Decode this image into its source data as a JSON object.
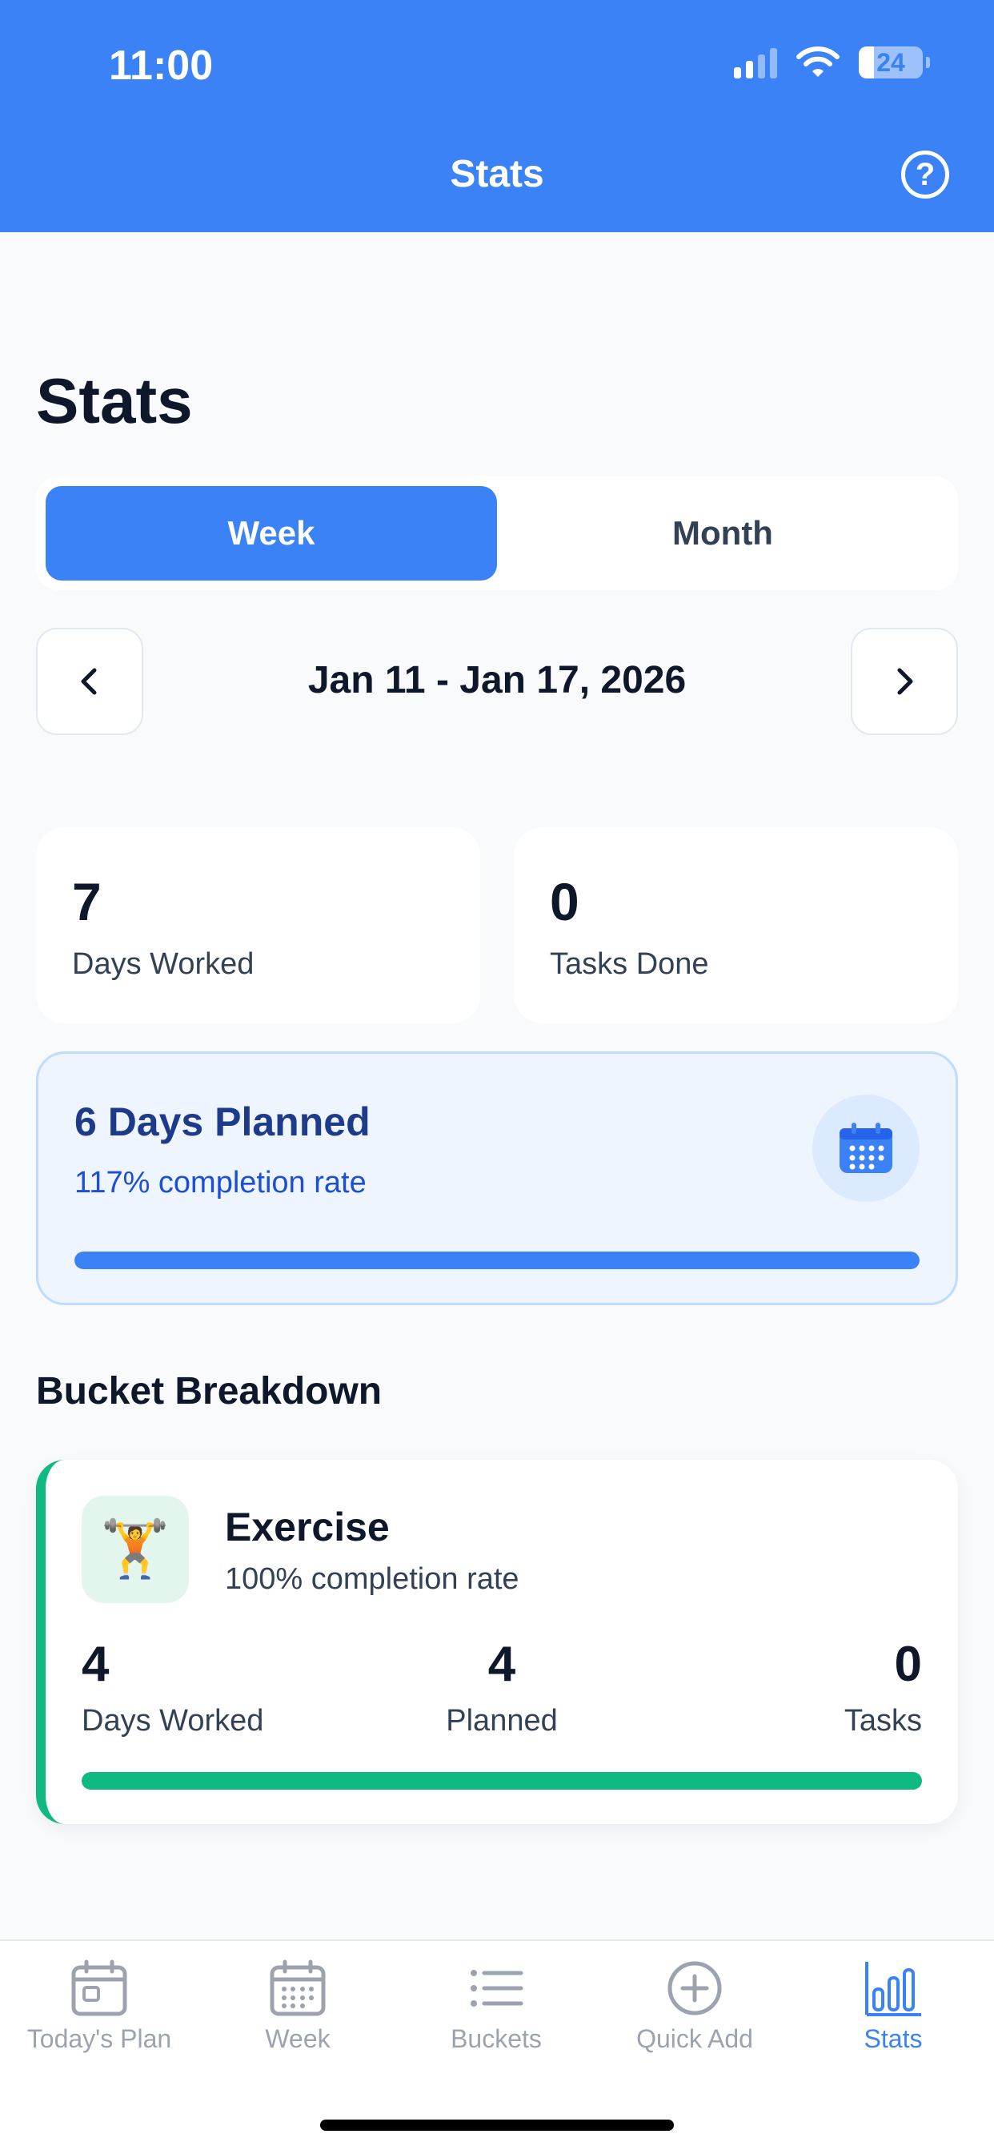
{
  "status_bar": {
    "time": "11:00",
    "battery_level": "24",
    "battery_fraction": 0.24
  },
  "header": {
    "title": "Stats",
    "help_icon": "question-circle-icon"
  },
  "page": {
    "title": "Stats"
  },
  "period_toggle": {
    "options": [
      "Week",
      "Month"
    ],
    "selected": "Week"
  },
  "date_nav": {
    "range": "Jan 11 - Jan 17, 2026",
    "prev_icon": "chevron-left-icon",
    "next_icon": "chevron-right-icon"
  },
  "summary": {
    "days_worked": {
      "value": "7",
      "label": "Days Worked"
    },
    "tasks_done": {
      "value": "0",
      "label": "Tasks Done"
    }
  },
  "planned": {
    "title": "6 Days Planned",
    "rate": "117% completion rate",
    "progress": 1.0,
    "icon": "calendar-icon"
  },
  "breakdown": {
    "title": "Bucket Breakdown",
    "buckets": [
      {
        "name": "Exercise",
        "emoji": "🏋️",
        "rate": "100% completion rate",
        "days_worked": "4",
        "days_worked_label": "Days Worked",
        "planned": "4",
        "planned_label": "Planned",
        "tasks": "0",
        "tasks_label": "Tasks",
        "progress": 1.0,
        "accent": "#10b981"
      }
    ]
  },
  "tabs": [
    {
      "label": "Today's Plan",
      "icon": "today-calendar-icon"
    },
    {
      "label": "Week",
      "icon": "week-calendar-icon"
    },
    {
      "label": "Buckets",
      "icon": "list-icon"
    },
    {
      "label": "Quick Add",
      "icon": "plus-circle-icon"
    },
    {
      "label": "Stats",
      "icon": "bar-chart-icon",
      "active": true
    }
  ],
  "colors": {
    "primary": "#3b82f6",
    "success": "#10b981",
    "background": "#f8fafc"
  }
}
